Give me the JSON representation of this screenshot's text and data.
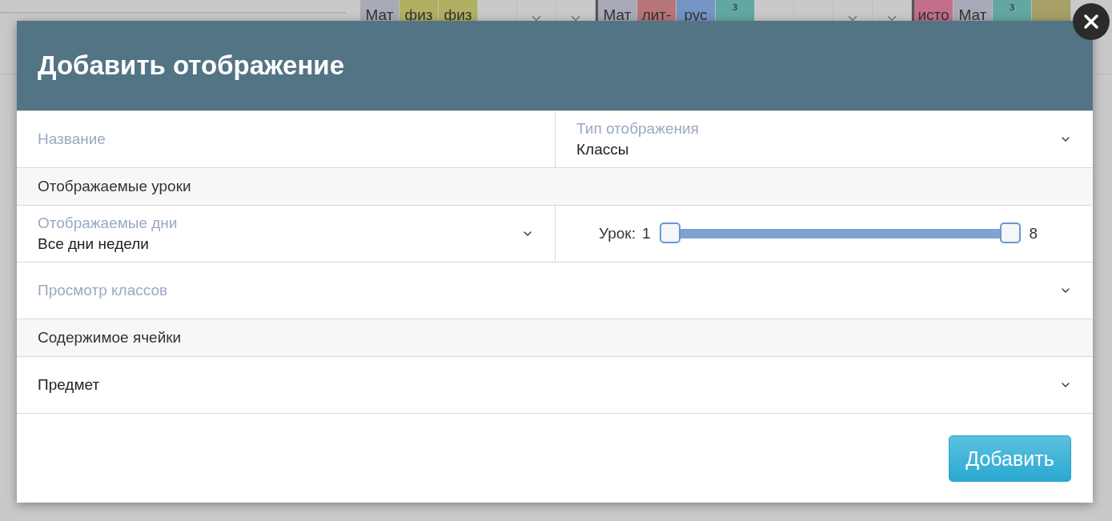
{
  "background": {
    "cells": [
      {
        "kind": "text",
        "text": "Мат",
        "color": "#a9aab7"
      },
      {
        "kind": "text",
        "text": "физ",
        "color": "#b1b062"
      },
      {
        "kind": "text",
        "text": "физ",
        "color": "#b1b062"
      },
      {
        "kind": "empty"
      },
      {
        "kind": "chevron"
      },
      {
        "kind": "chevron"
      },
      {
        "kind": "divider"
      },
      {
        "kind": "text",
        "text": "Мат",
        "color": "#a9aab7"
      },
      {
        "kind": "text",
        "text": "лит-",
        "color": "#b87579"
      },
      {
        "kind": "text",
        "text": "рус",
        "color": "#7494c6"
      },
      {
        "kind": "top",
        "text": "з",
        "color": "#63a7a2"
      },
      {
        "kind": "empty"
      },
      {
        "kind": "empty"
      },
      {
        "kind": "chevron"
      },
      {
        "kind": "chevron"
      },
      {
        "kind": "divider"
      },
      {
        "kind": "text",
        "text": "исто",
        "color": "#c46e8a"
      },
      {
        "kind": "text",
        "text": "Мат",
        "color": "#a9aab7"
      },
      {
        "kind": "top",
        "text": "з",
        "color": "#63a7a2"
      },
      {
        "kind": "blank",
        "color": "#a69f67"
      }
    ]
  },
  "dialog": {
    "title": "Добавить отображение",
    "rows": [
      {
        "kind": "pair",
        "fields": [
          {
            "kind": "input",
            "placeholder": "Название"
          },
          {
            "kind": "select",
            "label": "Тип отображения",
            "value": "Классы"
          }
        ]
      },
      {
        "kind": "section",
        "label": "Отображаемые уроки"
      },
      {
        "kind": "pair",
        "fields": [
          {
            "kind": "select",
            "label": "Отображаемые дни",
            "value": "Все дни недели"
          },
          {
            "kind": "range",
            "label": "Урок:",
            "min": "1",
            "max": "8",
            "thumbs": [
              {
                "level": 0
              },
              {
                "level": 1
              }
            ]
          }
        ]
      },
      {
        "kind": "full",
        "fields": [
          {
            "kind": "select",
            "placeholder": "Просмотр классов"
          }
        ]
      },
      {
        "kind": "section",
        "label": "Содержимое ячейки"
      },
      {
        "kind": "full",
        "fields": [
          {
            "kind": "select",
            "value": "Предмет"
          }
        ]
      }
    ],
    "submit": "Добавить"
  }
}
